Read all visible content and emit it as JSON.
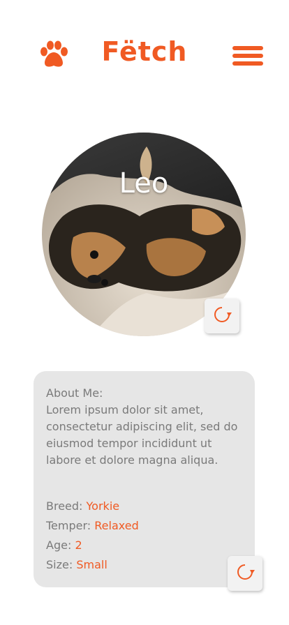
{
  "app": {
    "title": "Fëtch",
    "accent": "#f05a23"
  },
  "header": {
    "left_icon": "paw-icon",
    "right_icon": "menu-icon"
  },
  "profile": {
    "name": "Leo",
    "refresh_icon": "refresh-icon"
  },
  "about": {
    "heading": "About Me:",
    "text": "Lorem ipsum dolor sit amet, consectetur adipiscing elit, sed do eiusmod tempor incididunt ut labore et dolore magna aliqua.",
    "breed_label": "Breed:",
    "breed_value": "Yorkie",
    "temper_label": "Temper:",
    "temper_value": "Relaxed",
    "age_label": "Age:",
    "age_value": "2",
    "size_label": "Size:",
    "size_value": "Small"
  },
  "colors": {
    "card_bg": "#e6e6e6",
    "label_gray": "#7a7a7a"
  }
}
